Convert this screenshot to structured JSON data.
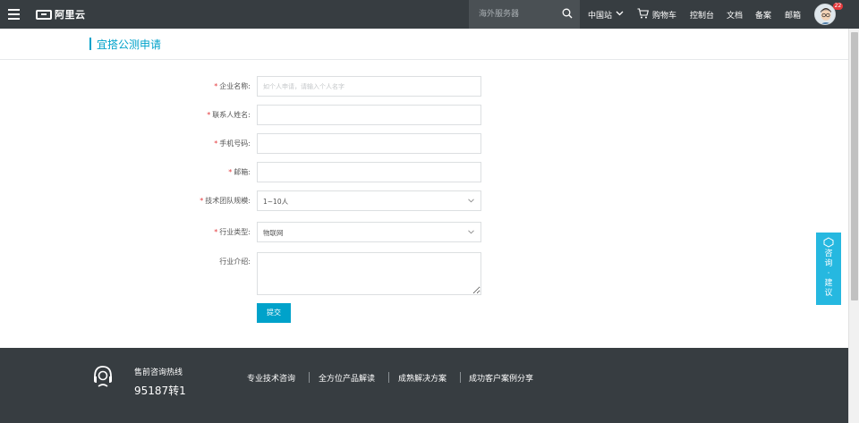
{
  "topbar": {
    "logo_text": "阿里云",
    "search_placeholder": "海外服务器",
    "region": "中国站",
    "nav": [
      "购物车",
      "控制台",
      "文档",
      "备案",
      "邮箱"
    ],
    "avatar_badge": "22"
  },
  "page_title": "宜搭公测申请",
  "form": {
    "company": {
      "label": "企业名称:",
      "placeholder": "如个人申请，请输入个人名字",
      "required": true
    },
    "contact": {
      "label": "联系人姓名:",
      "required": true
    },
    "phone": {
      "label": "手机号码:",
      "required": true
    },
    "email": {
      "label": "邮箱:",
      "required": true
    },
    "team_size": {
      "label": "技术团队规模:",
      "value": "1~10人",
      "required": true
    },
    "industry": {
      "label": "行业类型:",
      "value": "物联网",
      "required": true
    },
    "intro": {
      "label": "行业介绍:"
    },
    "submit_label": "提交",
    "required_mark": "*"
  },
  "consult": {
    "text": "咨询·建议"
  },
  "footer": {
    "hotline_label": "售前咨询热线",
    "hotline_number": "95187转1",
    "links": [
      "专业技术咨询",
      "全方位产品解读",
      "成熟解决方案",
      "成功客户案例分享"
    ]
  },
  "colors": {
    "accent": "#00a2ca",
    "topbar": "#373d41",
    "consult": "#26b8e0",
    "required": "#e4393c"
  }
}
